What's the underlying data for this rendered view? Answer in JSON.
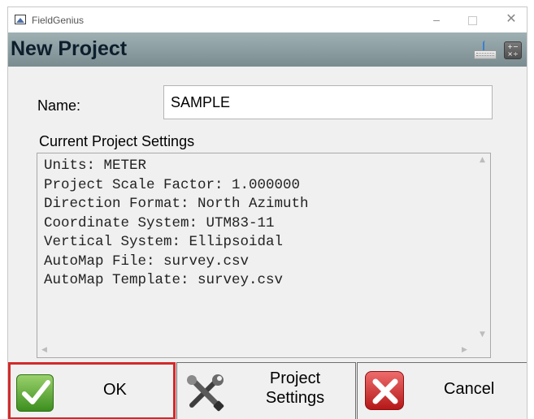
{
  "window": {
    "title": "FieldGenius",
    "minimize_glyph": "–",
    "close_glyph": "✕"
  },
  "header": {
    "title": "New Project",
    "icons": [
      "keyboard-icon",
      "calculator-icon"
    ],
    "calculator_glyphs": "+−\n×÷"
  },
  "form": {
    "name_label": "Name:",
    "name_value": "SAMPLE",
    "settings_label": "Current Project Settings",
    "settings_lines": [
      "Units: METER",
      "Project Scale Factor: 1.000000",
      "Direction Format: North Azimuth",
      "Coordinate System: UTM83-11",
      "Vertical System: Ellipsoidal",
      "AutoMap File: survey.csv",
      "AutoMap Template: survey.csv"
    ]
  },
  "buttons": {
    "ok": {
      "label": "OK",
      "icon": "check-icon"
    },
    "project_settings": {
      "label_line1": "Project",
      "label_line2": "Settings",
      "icon": "tools-icon"
    },
    "cancel": {
      "label": "Cancel",
      "icon": "x-icon"
    }
  },
  "colors": {
    "header_bg": "#8a9ca0",
    "ok_highlight": "#d22a2a",
    "ok_icon": "#4fa32a",
    "cancel_icon": "#d23030"
  }
}
